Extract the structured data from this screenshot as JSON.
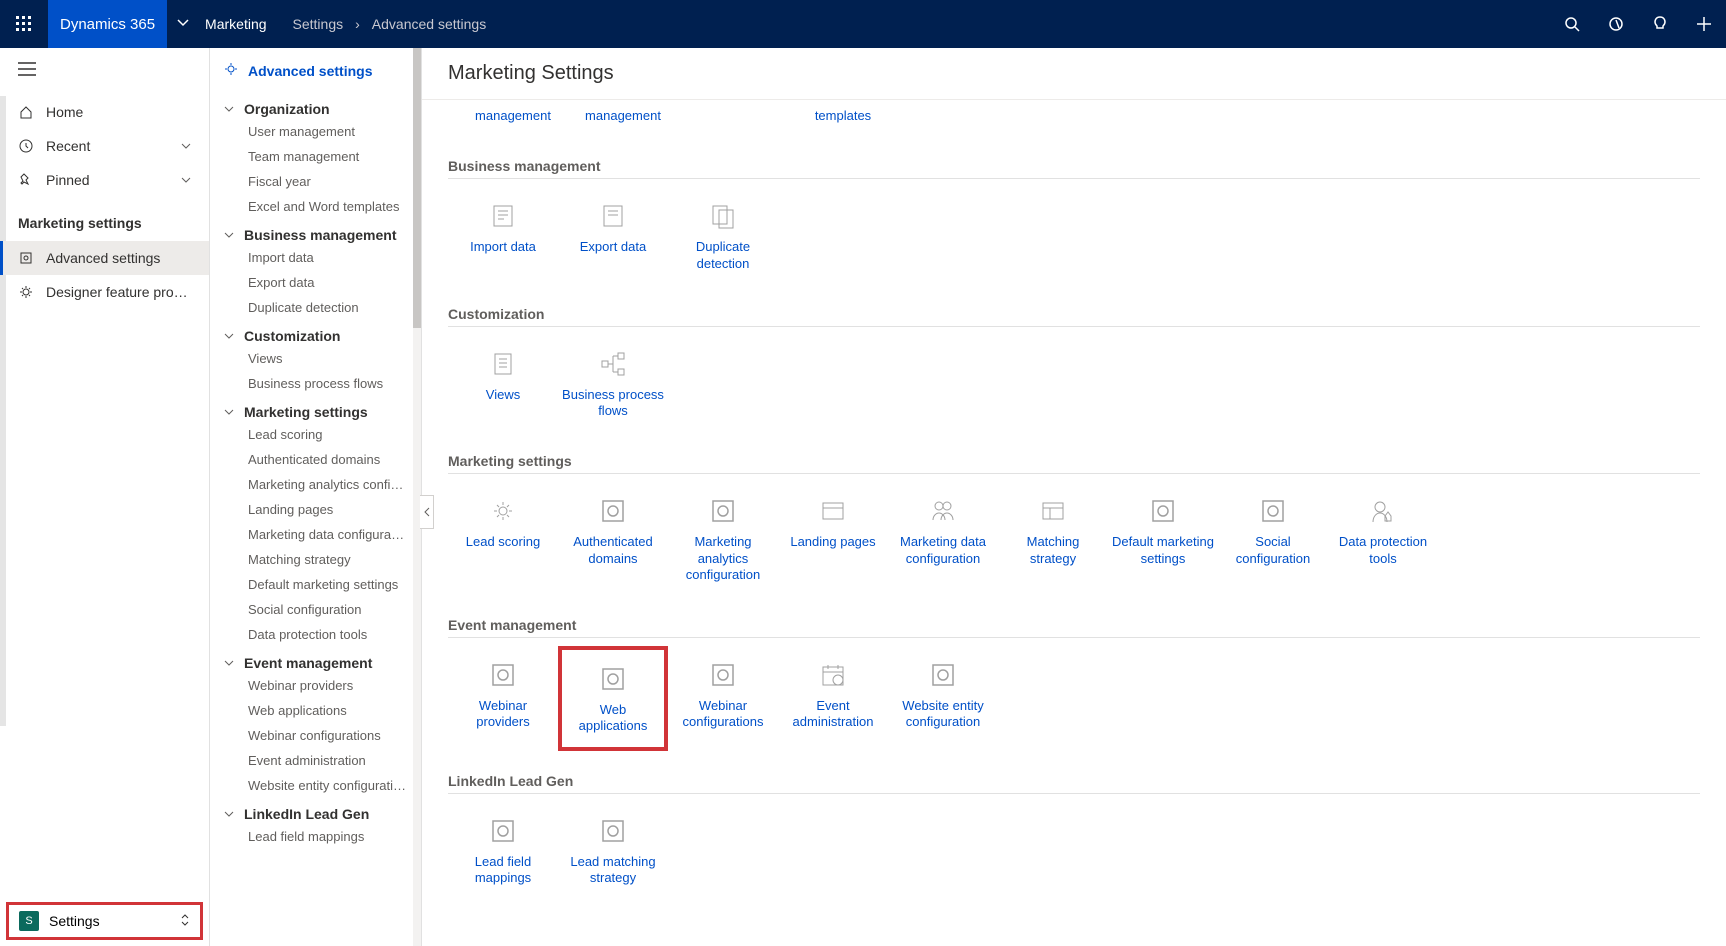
{
  "topbar": {
    "product": "Dynamics 365",
    "app": "Marketing",
    "crumb1": "Settings",
    "crumb2": "Advanced settings"
  },
  "nav1": {
    "home": "Home",
    "recent": "Recent",
    "pinned": "Pinned",
    "section": "Marketing settings",
    "adv": "Advanced settings",
    "designer": "Designer feature pro…",
    "footer_badge": "S",
    "footer": "Settings"
  },
  "nav2": {
    "title": "Advanced settings",
    "groups": [
      {
        "label": "Organization",
        "items": [
          "User management",
          "Team management",
          "Fiscal year",
          "Excel and Word templates"
        ]
      },
      {
        "label": "Business management",
        "items": [
          "Import data",
          "Export data",
          "Duplicate detection"
        ]
      },
      {
        "label": "Customization",
        "items": [
          "Views",
          "Business process flows"
        ]
      },
      {
        "label": "Marketing settings",
        "items": [
          "Lead scoring",
          "Authenticated domains",
          "Marketing analytics config…",
          "Landing pages",
          "Marketing data configurat…",
          "Matching strategy",
          "Default marketing settings",
          "Social configuration",
          "Data protection tools"
        ]
      },
      {
        "label": "Event management",
        "items": [
          "Webinar providers",
          "Web applications",
          "Webinar configurations",
          "Event administration",
          "Website entity configurati…"
        ]
      },
      {
        "label": "LinkedIn Lead Gen",
        "items": [
          "Lead field mappings"
        ]
      }
    ]
  },
  "main": {
    "title": "Marketing Settings",
    "residual": [
      "management",
      "management",
      "templates"
    ],
    "sections": [
      {
        "title": "Business management",
        "tiles": [
          "Import data",
          "Export data",
          "Duplicate detection"
        ]
      },
      {
        "title": "Customization",
        "tiles": [
          "Views",
          "Business process flows"
        ]
      },
      {
        "title": "Marketing settings",
        "tiles": [
          "Lead scoring",
          "Authenticated domains",
          "Marketing analytics configuration",
          "Landing pages",
          "Marketing data configuration",
          "Matching strategy",
          "Default marketing settings",
          "Social configuration",
          "Data protection tools"
        ]
      },
      {
        "title": "Event management",
        "tiles": [
          "Webinar providers",
          "Web applications",
          "Webinar configurations",
          "Event administration",
          "Website entity configuration"
        ]
      },
      {
        "title": "LinkedIn Lead Gen",
        "tiles": [
          "Lead field mappings",
          "Lead matching strategy"
        ]
      }
    ],
    "highlight": "Web applications"
  }
}
